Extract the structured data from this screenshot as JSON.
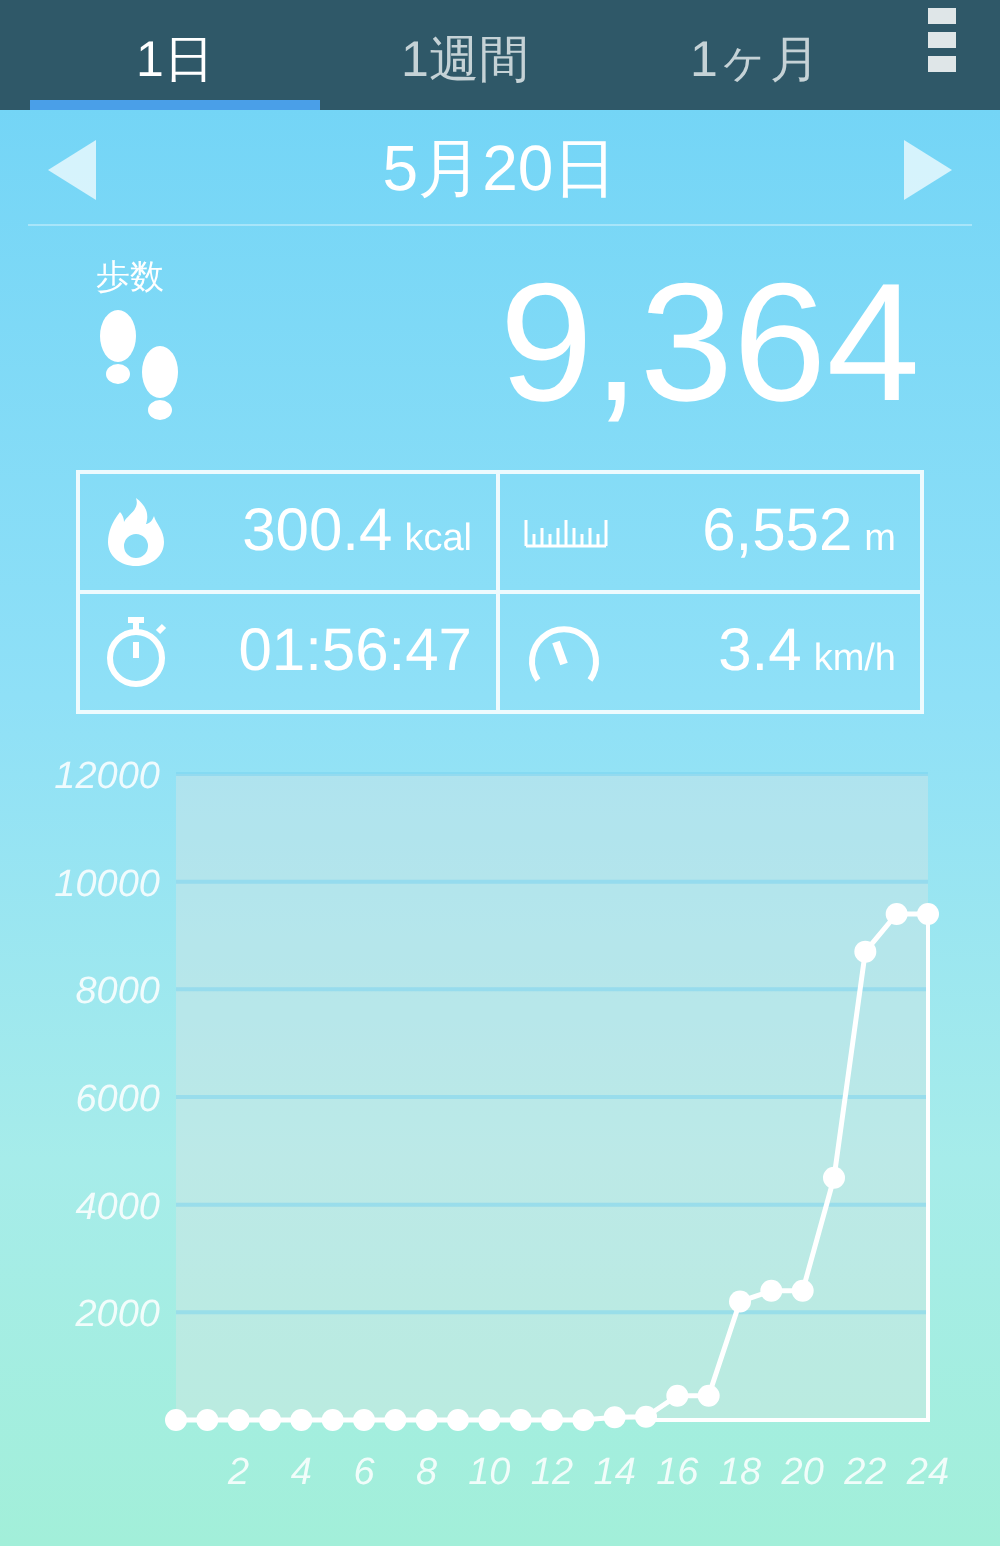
{
  "tabs": [
    {
      "label": "1日",
      "selected": true
    },
    {
      "label": "1週間",
      "selected": false
    },
    {
      "label": "1ヶ月",
      "selected": false
    }
  ],
  "date": "5月20日",
  "steps": {
    "label": "歩数",
    "value": "9,364"
  },
  "stats": [
    {
      "kind": "calories",
      "value": "300.4",
      "unit": "kcal"
    },
    {
      "kind": "distance",
      "value": "6,552",
      "unit": "m"
    },
    {
      "kind": "time",
      "value": "01:56:47"
    },
    {
      "kind": "speed",
      "value": "3.4",
      "unit": "km/h"
    }
  ],
  "chart_data": {
    "type": "line",
    "x": [
      0,
      1,
      2,
      3,
      4,
      5,
      6,
      7,
      8,
      9,
      10,
      11,
      12,
      13,
      14,
      15,
      16,
      17,
      18,
      19,
      20,
      21,
      22,
      23,
      24
    ],
    "grid": true,
    "series": [
      {
        "color": "#ffffff",
        "marker": true,
        "values": [
          0,
          0,
          0,
          0,
          0,
          0,
          0,
          0,
          0,
          0,
          0,
          0,
          0,
          0,
          50,
          60,
          450,
          450,
          2200,
          2400,
          2400,
          4500,
          8700,
          9400,
          9400
        ]
      }
    ],
    "xlim": [
      0,
      24
    ],
    "ylim": [
      0,
      12000
    ],
    "xticks": [
      2,
      4,
      6,
      8,
      10,
      12,
      14,
      16,
      18,
      20,
      22,
      24
    ],
    "yticks": [
      2000,
      4000,
      6000,
      8000,
      10000,
      12000
    ]
  }
}
